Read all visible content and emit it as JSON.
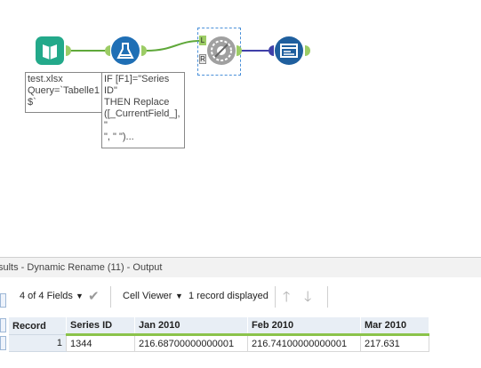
{
  "workflow": {
    "annotation_input": "test.xlsx\nQuery=`Tabelle1\n$`",
    "annotation_formula": "IF [F1]=\"Series\nID\"\nTHEN Replace\n([_CurrentField_],\n\"\n\", \" \")...",
    "anchor_l": "L",
    "anchor_r": "R",
    "colors": {
      "input_tool": "#23a98a",
      "formula_tool": "#1f6fb5",
      "dynamic_rename_tool": "#a0a0a0",
      "browse_tool": "#1f5f9e",
      "connection": "#5fa83a",
      "output_connection": "#3f3fa8"
    }
  },
  "results": {
    "title": "sults - Dynamic Rename (11) - Output",
    "fields_label": "4 of 4 Fields",
    "viewer_label": "Cell Viewer",
    "records_label": "1 record displayed",
    "columns": [
      "Record",
      "Series ID",
      "Jan  2010",
      "Feb 2010",
      "Mar 2010"
    ],
    "rows": [
      [
        "1",
        "1344",
        "216.68700000000001",
        "216.74100000000001",
        "217.631"
      ]
    ]
  }
}
